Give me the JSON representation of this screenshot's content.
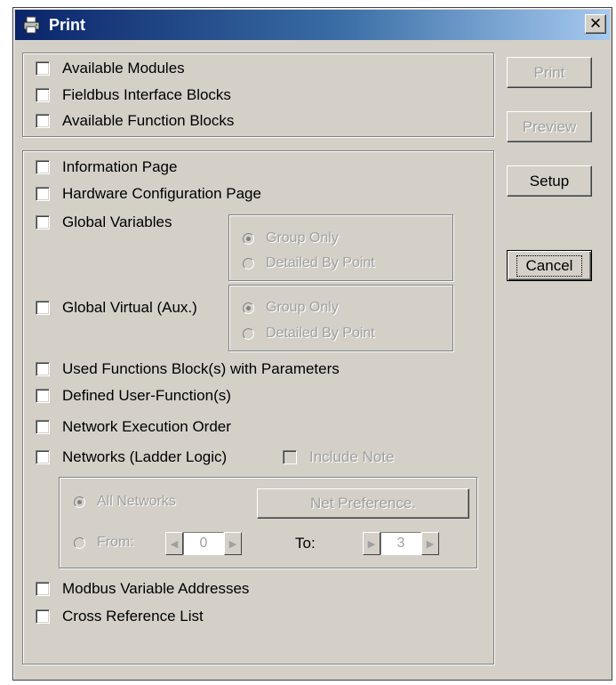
{
  "window": {
    "title": "Print",
    "close_glyph": "✕"
  },
  "top_group": {
    "items": [
      {
        "label": "Available Modules",
        "checked": false
      },
      {
        "label": "Fieldbus Interface Blocks",
        "checked": false
      },
      {
        "label": "Available Function Blocks",
        "checked": false
      }
    ]
  },
  "main_group": {
    "information_page": "Information Page",
    "hardware_configuration_page": "Hardware Configuration Page",
    "global_variables": {
      "label": "Global Variables",
      "options": [
        "Group Only",
        "Detailed By Point"
      ],
      "selected": "Group Only"
    },
    "global_virtual": {
      "label": "Global Virtual (Aux.)",
      "options": [
        "Group Only",
        "Detailed By Point"
      ],
      "selected": "Group Only"
    },
    "used_functions": "Used Functions Block(s) with Parameters",
    "defined_user_functions": "Defined User-Function(s)",
    "network_execution_order": "Network Execution Order",
    "networks_ladder_logic": "Networks (Ladder Logic)",
    "include_note": "Include Note",
    "networks_box": {
      "all_networks": "All Networks",
      "net_preference": "Net Preference.",
      "from_label": "From:",
      "from_value": "0",
      "to_label": "To:",
      "to_value": "3"
    },
    "modbus_variable_addresses": "Modbus Variable Addresses",
    "cross_reference_list": "Cross Reference List"
  },
  "buttons": {
    "print": {
      "label": "Print",
      "enabled": false
    },
    "preview": {
      "label": "Preview",
      "enabled": false
    },
    "setup": {
      "label": "Setup",
      "enabled": true
    },
    "cancel": {
      "label": "Cancel",
      "enabled": true,
      "default": true
    }
  },
  "colors": {
    "titlebar_start": "#0a246a",
    "titlebar_end": "#a6caf0",
    "dialog_face": "#d4d0c8",
    "disabled_text": "#a0a0a0"
  },
  "icons": {
    "title": "printer-icon",
    "close": "close-icon",
    "spin_left": "arrow-left-icon",
    "spin_right": "arrow-right-icon"
  }
}
